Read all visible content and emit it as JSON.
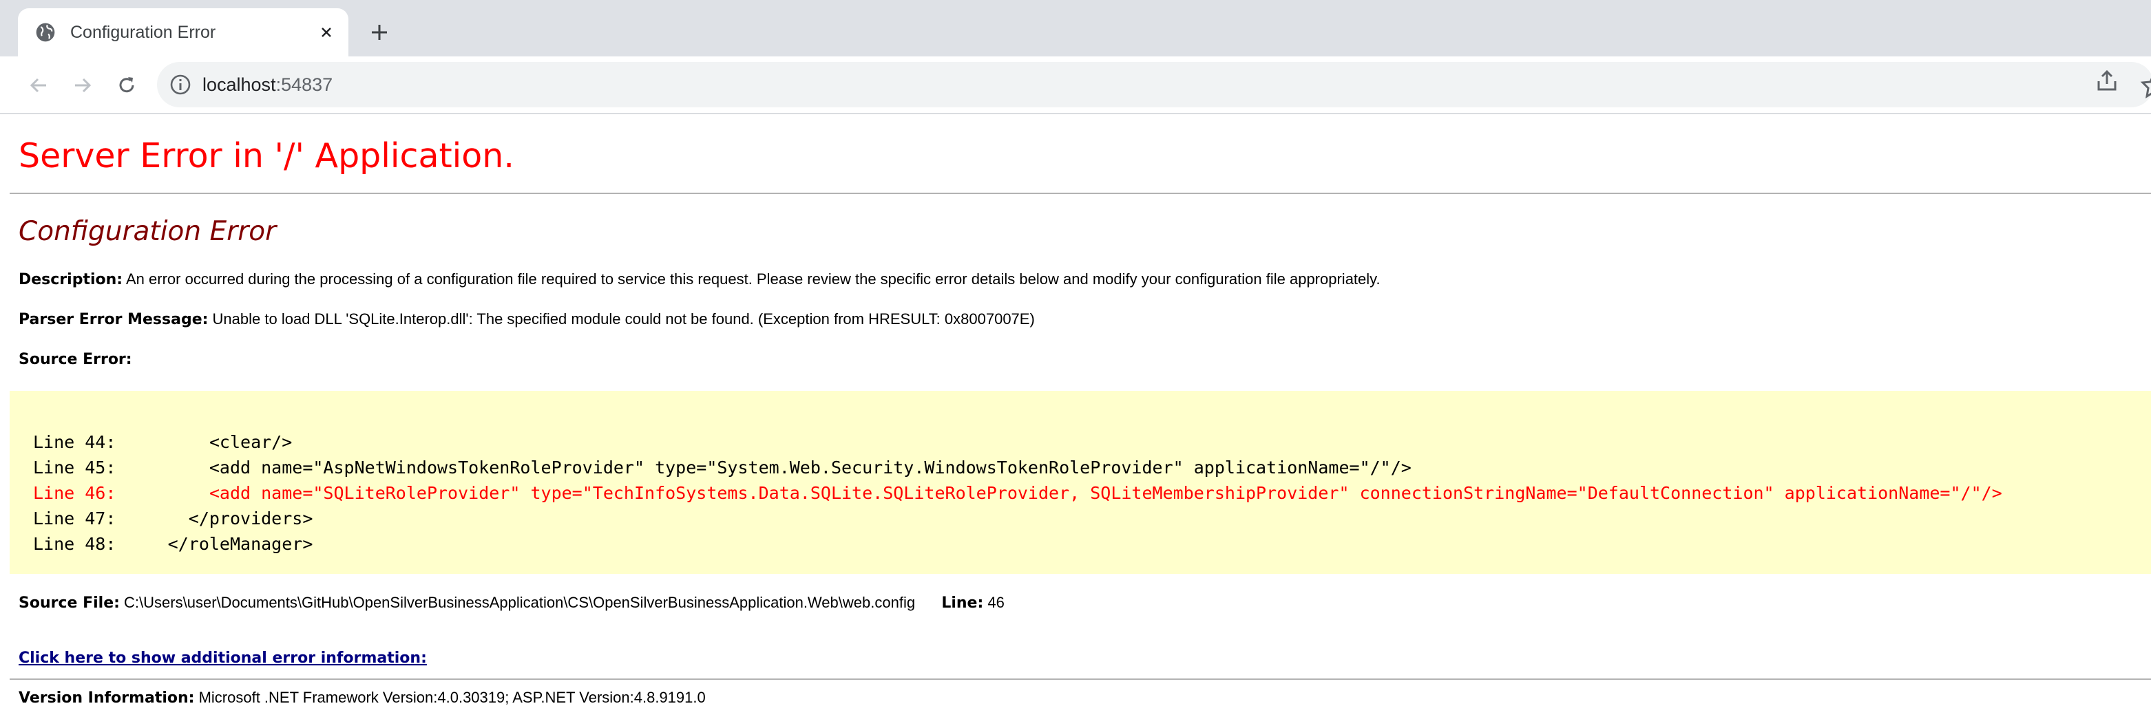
{
  "browser": {
    "tab_title": "Configuration Error",
    "url_host": "localhost",
    "url_port": ":54837"
  },
  "page": {
    "heading": "Server Error in '/' Application.",
    "subheading": "Configuration Error",
    "description_label": "Description:",
    "description_text": "An error occurred during the processing of a configuration file required to service this request. Please review the specific error details below and modify your configuration file appropriately.",
    "parser_label": "Parser Error Message:",
    "parser_text": "Unable to load DLL 'SQLite.Interop.dll': The specified module could not be found. (Exception from HRESULT: 0x8007007E)",
    "source_error_label": "Source Error:",
    "source_lines": [
      {
        "text": "Line 44:         <clear/>",
        "error": false
      },
      {
        "text": "Line 45:         <add name=\"AspNetWindowsTokenRoleProvider\" type=\"System.Web.Security.WindowsTokenRoleProvider\" applicationName=\"/\"/>",
        "error": false
      },
      {
        "text": "Line 46:         <add name=\"SQLiteRoleProvider\" type=\"TechInfoSystems.Data.SQLite.SQLiteRoleProvider, SQLiteMembershipProvider\" connectionStringName=\"DefaultConnection\" applicationName=\"/\"/>",
        "error": true
      },
      {
        "text": "Line 47:       </providers>",
        "error": false
      },
      {
        "text": "Line 48:     </roleManager>",
        "error": false
      }
    ],
    "source_file_label": "Source File:",
    "source_file_path": "C:\\Users\\user\\Documents\\GitHub\\OpenSilverBusinessApplication\\CS\\OpenSilverBusinessApplication.Web\\web.config",
    "line_label": "Line:",
    "line_value": "46",
    "additional_info_link": "Click here to show additional error information:",
    "version_label": "Version Information:",
    "version_text": "Microsoft .NET Framework Version:4.0.30319; ASP.NET Version:4.8.9191.0"
  },
  "colors": {
    "heading": "#ff0000",
    "subheading": "#800000",
    "source_bg": "#ffffcc",
    "link": "#000080"
  }
}
